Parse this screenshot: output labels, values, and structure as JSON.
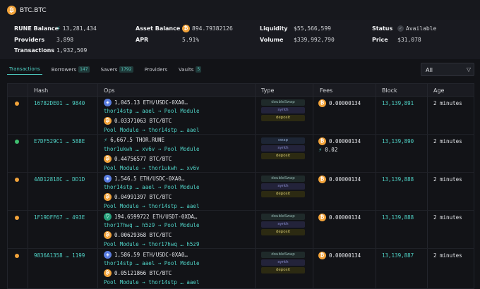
{
  "pool": {
    "title": "BTC.BTC",
    "icon": "bitcoin-icon"
  },
  "stats": {
    "rune_balance": {
      "label": "RUNE Balance",
      "value": "13,281,434"
    },
    "providers": {
      "label": "Providers",
      "value": "3,898"
    },
    "transactions": {
      "label": "Transactions",
      "value": "1,932,509"
    },
    "asset_balance": {
      "label": "Asset Balance",
      "value": "894.79382126"
    },
    "apr": {
      "label": "APR",
      "value": "5.91%"
    },
    "liquidity": {
      "label": "Liquidity",
      "value": "$55,566,599"
    },
    "volume": {
      "label": "Volume",
      "value": "$339,992,790"
    },
    "status": {
      "label": "Status",
      "value": "Available"
    },
    "price": {
      "label": "Price",
      "value": "$31,078"
    }
  },
  "tabs": [
    {
      "label": "Transactions",
      "badge": ""
    },
    {
      "label": "Borrowers",
      "badge": "147"
    },
    {
      "label": "Savers",
      "badge": "1792"
    },
    {
      "label": "Providers",
      "badge": ""
    },
    {
      "label": "Vaults",
      "badge": "5"
    }
  ],
  "filter": {
    "value": "All"
  },
  "columns": {
    "hash": "Hash",
    "ops": "Ops",
    "type": "Type",
    "fees": "Fees",
    "block": "Block",
    "age": "Age"
  },
  "colors": {
    "accent": "#4fd1c5",
    "btc": "#f2a33a",
    "success": "#3fbf6f"
  },
  "rows": [
    {
      "hash": "16782DE01 … 9840",
      "op1_amount": "1,045.13 ETH/USDC-0XA0…",
      "op1_route": "thor14stp … aael → Pool Module",
      "op2_amount": "0.03371063 BTC/BTC",
      "op2_route": "Pool Module → thor14stp … aael",
      "types": [
        "doubleSwap",
        "synth",
        "deposit"
      ],
      "fee1": "0.00000134",
      "block": "13,139,891",
      "age": "2 minutes"
    },
    {
      "hash": "E7DF529C1 … 588E",
      "op1_amount": "6,667.5 THOR.RUNE",
      "op1_route": "thor1ukwh … xv6v → Pool Module",
      "op2_amount": "0.44756577 BTC/BTC",
      "op2_route": "Pool Module → thor1ukwh … xv6v",
      "types": [
        "swap",
        "synth",
        "deposit"
      ],
      "fee1": "0.00000134",
      "fee2": "0.02",
      "block": "13,139,890",
      "age": "2 minutes"
    },
    {
      "hash": "4AD12818C … DD1D",
      "op1_amount": "1,546.5 ETH/USDC-0XA0…",
      "op1_route": "thor14stp … aael → Pool Module",
      "op2_amount": "0.04991397 BTC/BTC",
      "op2_route": "Pool Module → thor14stp … aael",
      "types": [
        "doubleSwap",
        "synth",
        "deposit"
      ],
      "fee1": "0.00000134",
      "block": "13,139,888",
      "age": "2 minutes"
    },
    {
      "hash": "1F19DFF67 … 493E",
      "op1_amount": "194.6599722 ETH/USDT-0XDA…",
      "op1_route": "thor17hwq … h5z9 → Pool Module",
      "op2_amount": "0.00629368 BTC/BTC",
      "op2_route": "Pool Module → thor17hwq … h5z9",
      "types": [
        "doubleSwap",
        "synth",
        "deposit"
      ],
      "fee1": "0.00000134",
      "block": "13,139,888",
      "age": "2 minutes"
    },
    {
      "hash": "9836A1358 … 1199",
      "op1_amount": "1,586.59 ETH/USDC-0XA0…",
      "op1_route": "thor14stp … aael → Pool Module",
      "op2_amount": "0.05121866 BTC/BTC",
      "op2_route": "Pool Module → thor14stp … aael",
      "types": [
        "doubleSwap",
        "synth",
        "deposit"
      ],
      "fee1": "0.00000134",
      "block": "13,139,887",
      "age": "2 minutes"
    }
  ]
}
